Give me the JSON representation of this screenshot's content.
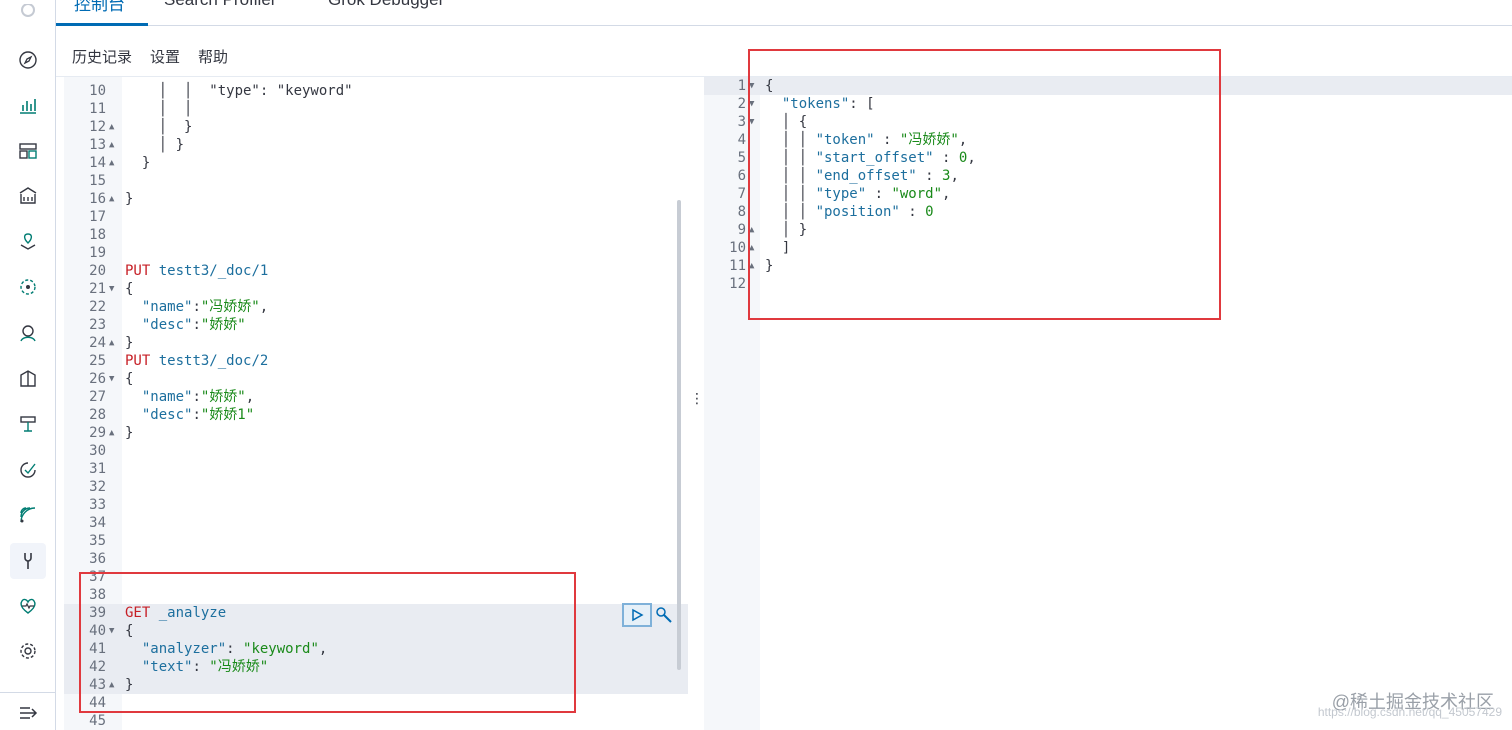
{
  "tabs": [
    "控制台",
    "Search Profiler",
    "Grok Debugger"
  ],
  "menu": [
    "历史记录",
    "设置",
    "帮助"
  ],
  "rail_icons": [
    "compass-icon",
    "chart-icon",
    "dashboard-icon",
    "canvas-icon",
    "maps-icon",
    "ml-icon",
    "graph-icon",
    "apm-icon",
    "uptime-icon",
    "siem-icon",
    "fleet-icon",
    "dev-tools-icon",
    "monitoring-icon",
    "gear-icon"
  ],
  "editor_lines": [
    {
      "n": "10",
      "fold": "",
      "code": [
        [
          "",
          "    │  │  \"type\": \"keyword\""
        ]
      ]
    },
    {
      "n": "11",
      "fold": "",
      "code": [
        [
          "",
          "    │  │"
        ]
      ]
    },
    {
      "n": "12",
      "fold": "▲",
      "code": [
        [
          "",
          "    │  }"
        ]
      ]
    },
    {
      "n": "13",
      "fold": "▲",
      "code": [
        [
          "",
          "    │ }"
        ]
      ]
    },
    {
      "n": "14",
      "fold": "▲",
      "code": [
        [
          "",
          "  }"
        ]
      ]
    },
    {
      "n": "15",
      "fold": "",
      "code": [
        [
          "",
          ""
        ]
      ]
    },
    {
      "n": "16",
      "fold": "▲",
      "code": [
        [
          "",
          "}"
        ]
      ]
    },
    {
      "n": "17",
      "fold": "",
      "code": [
        [
          "",
          ""
        ]
      ]
    },
    {
      "n": "18",
      "fold": "",
      "code": [
        [
          "",
          ""
        ]
      ]
    },
    {
      "n": "19",
      "fold": "",
      "code": [
        [
          "",
          ""
        ]
      ]
    },
    {
      "n": "20",
      "fold": "",
      "code": [
        [
          "m",
          "PUT"
        ],
        [
          "k",
          " testt3/_doc/1"
        ]
      ]
    },
    {
      "n": "21",
      "fold": "▼",
      "code": [
        [
          "",
          "{"
        ]
      ]
    },
    {
      "n": "22",
      "fold": "",
      "code": [
        [
          "",
          "  "
        ],
        [
          "k",
          "\"name\""
        ],
        [
          "",
          ":"
        ],
        [
          "s",
          "\"冯娇娇\""
        ],
        [
          "",
          ","
        ]
      ]
    },
    {
      "n": "23",
      "fold": "",
      "code": [
        [
          "",
          "  "
        ],
        [
          "k",
          "\"desc\""
        ],
        [
          "",
          ":"
        ],
        [
          "s",
          "\"娇娇\""
        ]
      ]
    },
    {
      "n": "24",
      "fold": "▲",
      "code": [
        [
          "",
          "}"
        ]
      ]
    },
    {
      "n": "25",
      "fold": "",
      "code": [
        [
          "m",
          "PUT"
        ],
        [
          "k",
          " testt3/_doc/2"
        ]
      ]
    },
    {
      "n": "26",
      "fold": "▼",
      "code": [
        [
          "",
          "{"
        ]
      ]
    },
    {
      "n": "27",
      "fold": "",
      "code": [
        [
          "",
          "  "
        ],
        [
          "k",
          "\"name\""
        ],
        [
          "",
          ":"
        ],
        [
          "s",
          "\"娇娇\""
        ],
        [
          "",
          ","
        ]
      ]
    },
    {
      "n": "28",
      "fold": "",
      "code": [
        [
          "",
          "  "
        ],
        [
          "k",
          "\"desc\""
        ],
        [
          "",
          ":"
        ],
        [
          "s",
          "\"娇娇1\""
        ]
      ]
    },
    {
      "n": "29",
      "fold": "▲",
      "code": [
        [
          "",
          "}"
        ]
      ]
    },
    {
      "n": "30",
      "fold": "",
      "code": [
        [
          "",
          ""
        ]
      ]
    },
    {
      "n": "31",
      "fold": "",
      "code": [
        [
          "",
          ""
        ]
      ]
    },
    {
      "n": "32",
      "fold": "",
      "code": [
        [
          "",
          ""
        ]
      ]
    },
    {
      "n": "33",
      "fold": "",
      "code": [
        [
          "",
          ""
        ]
      ]
    },
    {
      "n": "34",
      "fold": "",
      "code": [
        [
          "",
          ""
        ]
      ]
    },
    {
      "n": "35",
      "fold": "",
      "code": [
        [
          "",
          ""
        ]
      ]
    },
    {
      "n": "36",
      "fold": "",
      "code": [
        [
          "",
          ""
        ]
      ]
    },
    {
      "n": "37",
      "fold": "",
      "code": [
        [
          "",
          ""
        ]
      ]
    },
    {
      "n": "38",
      "fold": "",
      "code": [
        [
          "",
          ""
        ]
      ]
    },
    {
      "n": "39",
      "fold": "",
      "code": [
        [
          "m",
          "GET"
        ],
        [
          "k",
          " _analyze"
        ]
      ]
    },
    {
      "n": "40",
      "fold": "▼",
      "code": [
        [
          "",
          "{"
        ]
      ]
    },
    {
      "n": "41",
      "fold": "",
      "code": [
        [
          "",
          "  "
        ],
        [
          "k",
          "\"analyzer\""
        ],
        [
          "",
          ": "
        ],
        [
          "s",
          "\"keyword\""
        ],
        [
          "",
          ","
        ]
      ]
    },
    {
      "n": "42",
      "fold": "",
      "code": [
        [
          "",
          "  "
        ],
        [
          "k",
          "\"text\""
        ],
        [
          "",
          ": "
        ],
        [
          "s",
          "\"冯娇娇\""
        ]
      ]
    },
    {
      "n": "43",
      "fold": "▲",
      "code": [
        [
          "",
          "}"
        ]
      ]
    },
    {
      "n": "44",
      "fold": "",
      "code": [
        [
          "",
          ""
        ]
      ]
    },
    {
      "n": "45",
      "fold": "",
      "code": [
        [
          "",
          ""
        ]
      ]
    }
  ],
  "output_lines": [
    {
      "n": "1",
      "fold": "▼",
      "code": [
        [
          "",
          "{"
        ]
      ]
    },
    {
      "n": "2",
      "fold": "▼",
      "code": [
        [
          "",
          "  "
        ],
        [
          "k",
          "\"tokens\""
        ],
        [
          "",
          ": ["
        ]
      ]
    },
    {
      "n": "3",
      "fold": "▼",
      "code": [
        [
          "",
          "  │ {"
        ]
      ]
    },
    {
      "n": "4",
      "fold": "",
      "code": [
        [
          "",
          "  │ │ "
        ],
        [
          "k",
          "\"token\""
        ],
        [
          "",
          " : "
        ],
        [
          "s",
          "\"冯娇娇\""
        ],
        [
          "",
          ","
        ]
      ]
    },
    {
      "n": "5",
      "fold": "",
      "code": [
        [
          "",
          "  │ │ "
        ],
        [
          "k",
          "\"start_offset\""
        ],
        [
          "",
          " : "
        ],
        [
          "s",
          "0"
        ],
        [
          "",
          ","
        ]
      ]
    },
    {
      "n": "6",
      "fold": "",
      "code": [
        [
          "",
          "  │ │ "
        ],
        [
          "k",
          "\"end_offset\""
        ],
        [
          "",
          " : "
        ],
        [
          "s",
          "3"
        ],
        [
          "",
          ","
        ]
      ]
    },
    {
      "n": "7",
      "fold": "",
      "code": [
        [
          "",
          "  │ │ "
        ],
        [
          "k",
          "\"type\""
        ],
        [
          "",
          " : "
        ],
        [
          "s",
          "\"word\""
        ],
        [
          "",
          ","
        ]
      ]
    },
    {
      "n": "8",
      "fold": "",
      "code": [
        [
          "",
          "  │ │ "
        ],
        [
          "k",
          "\"position\""
        ],
        [
          "",
          " : "
        ],
        [
          "s",
          "0"
        ]
      ]
    },
    {
      "n": "9",
      "fold": "▲",
      "code": [
        [
          "",
          "  │ }"
        ]
      ]
    },
    {
      "n": "10",
      "fold": "▲",
      "code": [
        [
          "",
          "  ]"
        ]
      ]
    },
    {
      "n": "11",
      "fold": "▲",
      "code": [
        [
          "",
          "}"
        ]
      ]
    },
    {
      "n": "12",
      "fold": "",
      "code": [
        [
          "",
          ""
        ]
      ]
    }
  ],
  "watermark": "@稀土掘金技术社区",
  "watermark_sub": "https://blog.csdn.net/qq_45057429"
}
